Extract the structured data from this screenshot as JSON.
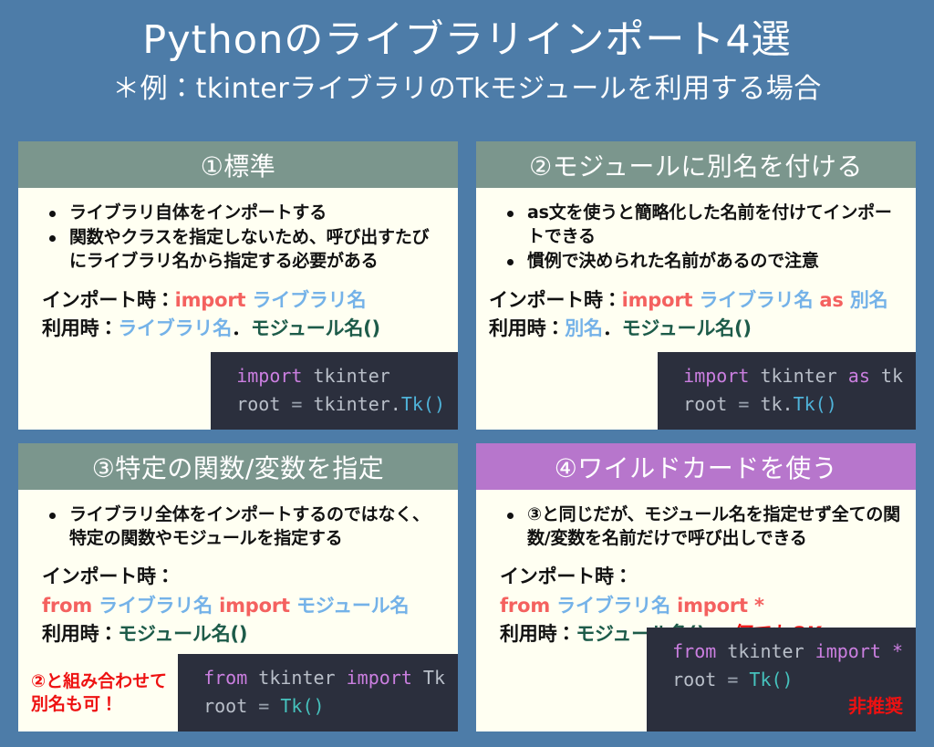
{
  "header": {
    "title": "Pythonのライブラリインポート4選",
    "subtitle": "＊例：tkinterライブラリのTkモジュールを利用する場合"
  },
  "colors": {
    "background": "#4d7ca8",
    "card_bg": "#fffff2",
    "header_green": "#7b968d",
    "header_purple": "#b776cc",
    "code_bg": "#2b2f3d",
    "keyword_red": "#f4615f",
    "library_blue": "#74b2e8",
    "module_green": "#1d5b49",
    "note_red": "#ee1111"
  },
  "cards": [
    {
      "title": "①標準",
      "header_color": "#7b968d",
      "bullets": [
        "ライブラリ自体をインポートする",
        "関数やクラスを指定しないため、呼び出すたびにライブラリ名から指定する必要がある"
      ],
      "syntax": {
        "import_label": "インポート時：",
        "import_keyword": "import",
        "import_target": "ライブラリ名",
        "usage_label": "利用時：",
        "usage_lib": "ライブラリ名",
        "usage_dot": "．",
        "usage_module": "モジュール名()"
      },
      "code": {
        "line1_kw": "import",
        "line1_rest": " tkinter",
        "line2_var": "root",
        "line2_op": " = ",
        "line2_obj": "tkinter.",
        "line2_cls": "Tk()"
      }
    },
    {
      "title": "②モジュールに別名を付ける",
      "header_color": "#7b968d",
      "bullets": [
        "as文を使うと簡略化した名前を付けてインポートできる",
        "慣例で決められた名前があるので注意"
      ],
      "syntax": {
        "import_label": "インポート時：",
        "import_keyword": "import",
        "import_target": "ライブラリ名",
        "as_keyword": "as",
        "alias": "別名",
        "usage_label": "利用時：",
        "usage_lib": "別名",
        "usage_dot": "．",
        "usage_module": "モジュール名()"
      },
      "code": {
        "line1_kw": "import",
        "line1_mid": " tkinter ",
        "line1_as": "as",
        "line1_alias": " tk",
        "line2_var": "root",
        "line2_op": " = ",
        "line2_obj": "tk.",
        "line2_cls": "Tk()"
      }
    },
    {
      "title": "③特定の関数/変数を指定",
      "header_color": "#7b968d",
      "bullets": [
        "ライブラリ全体をインポートするのではなく、特定の関数やモジュールを指定する"
      ],
      "syntax": {
        "import_label": "インポート時：",
        "from_keyword": "from",
        "from_target": "ライブラリ名",
        "import_keyword": "import",
        "import_module": "モジュール名",
        "usage_label": "利用時：",
        "usage_module": "モジュール名()"
      },
      "side_note": "②と組み合わせて\n別名も可！",
      "code": {
        "line1_kw": "from",
        "line1_mid": " tkinter ",
        "line1_kw2": "import",
        "line1_rest": " Tk",
        "line2_var": "root",
        "line2_op": " = ",
        "line2_cls": "Tk()"
      }
    },
    {
      "title": "④ワイルドカードを使う",
      "header_color": "#b776cc",
      "bullets": [
        "③と同じだが、モジュール名を指定せず全ての関数/変数を名前だけで呼び出しできる"
      ],
      "syntax": {
        "import_label": "インポート時：",
        "from_keyword": "from",
        "from_target": "ライブラリ名",
        "import_keyword": "import",
        "import_module": "*",
        "usage_label": "利用時：",
        "usage_module": "モジュール名()",
        "usage_note": "←何でもOK"
      },
      "code": {
        "line1_kw": "from",
        "line1_mid": " tkinter ",
        "line1_kw2": "import",
        "line1_rest": " *",
        "line2_var": "root",
        "line2_op": " = ",
        "line2_cls": "Tk()",
        "warning": "非推奨"
      }
    }
  ]
}
